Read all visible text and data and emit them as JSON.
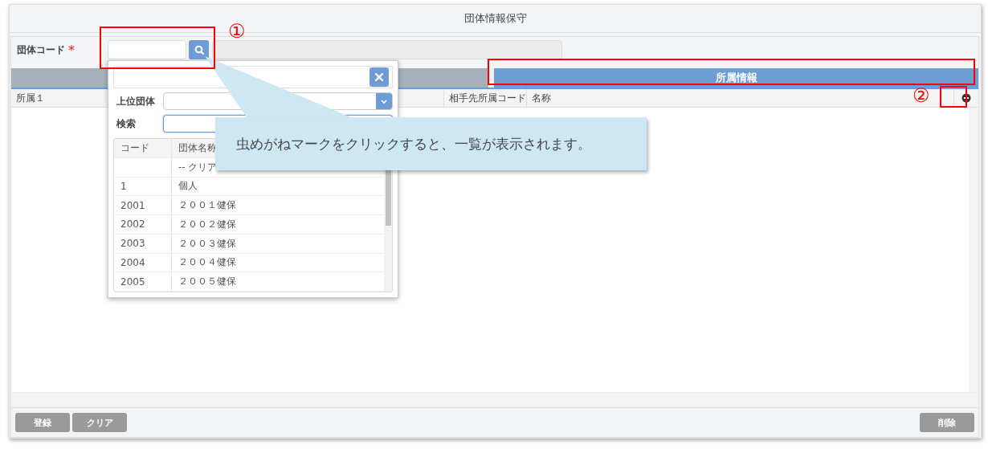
{
  "window": {
    "title": "団体情報保守"
  },
  "form": {
    "label": "団体コード",
    "required_mark": "*"
  },
  "tabs": [
    {
      "selected": false
    },
    {
      "label": "所属情報",
      "selected": true
    }
  ],
  "grid": {
    "columns": [
      "所属１",
      "相手先所属コード",
      "名称"
    ]
  },
  "popup": {
    "fields": [
      {
        "label": "上位団体",
        "kind": "select",
        "focused": false
      },
      {
        "label": "検索",
        "kind": "search",
        "focused": true
      }
    ],
    "table": {
      "columns": [
        "コード",
        "団体名称"
      ],
      "rows": [
        {
          "name": "-- クリア"
        },
        {
          "code": "1",
          "name": "個人"
        },
        {
          "code": "2001",
          "name": "２００１健保"
        },
        {
          "code": "2002",
          "name": "２００２健保"
        },
        {
          "code": "2003",
          "name": "２００３健保"
        },
        {
          "code": "2004",
          "name": "２００４健保"
        },
        {
          "code": "2005",
          "name": "２００５健保"
        }
      ]
    }
  },
  "callout": {
    "text": "虫めがねマークをクリックすると、一覧が表示されます。"
  },
  "annotations": [
    {
      "label": "①"
    },
    {
      "label": "②"
    }
  ],
  "buttons": {
    "left": [
      "登録",
      "クリア"
    ],
    "right": [
      "削除"
    ]
  }
}
